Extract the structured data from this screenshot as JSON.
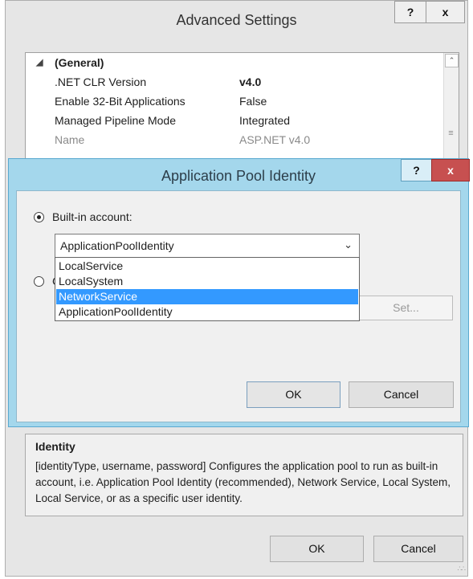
{
  "outer_window": {
    "title": "Advanced Settings",
    "help_label": "?",
    "close_label": "x"
  },
  "property_grid": {
    "category": "(General)",
    "rows": [
      {
        "key": ".NET CLR Version",
        "value": "v4.0"
      },
      {
        "key": "Enable 32-Bit Applications",
        "value": "False"
      },
      {
        "key": "Managed Pipeline Mode",
        "value": "Integrated"
      },
      {
        "key": "Name",
        "value": "ASP.NET v4.0"
      }
    ]
  },
  "description": {
    "title": "Identity",
    "text": "[identityType, username, password] Configures the application pool to run as built-in account, i.e. Application Pool Identity (recommended), Network Service, Local System, Local Service, or as a specific user identity."
  },
  "outer_buttons": {
    "ok": "OK",
    "cancel": "Cancel"
  },
  "dialog": {
    "title": "Application Pool Identity",
    "help_label": "?",
    "close_label": "x",
    "builtin_label": "Built-in account:",
    "custom_label": "C",
    "selected_account": "ApplicationPoolIdentity",
    "options": [
      "LocalService",
      "LocalSystem",
      "NetworkService",
      "ApplicationPoolIdentity"
    ],
    "highlighted_option": "NetworkService",
    "set_label": "Set...",
    "ok": "OK",
    "cancel": "Cancel"
  },
  "colors": {
    "dialog_frame": "#a4d7ec",
    "close_button": "#c75050",
    "selection": "#3399ff"
  }
}
